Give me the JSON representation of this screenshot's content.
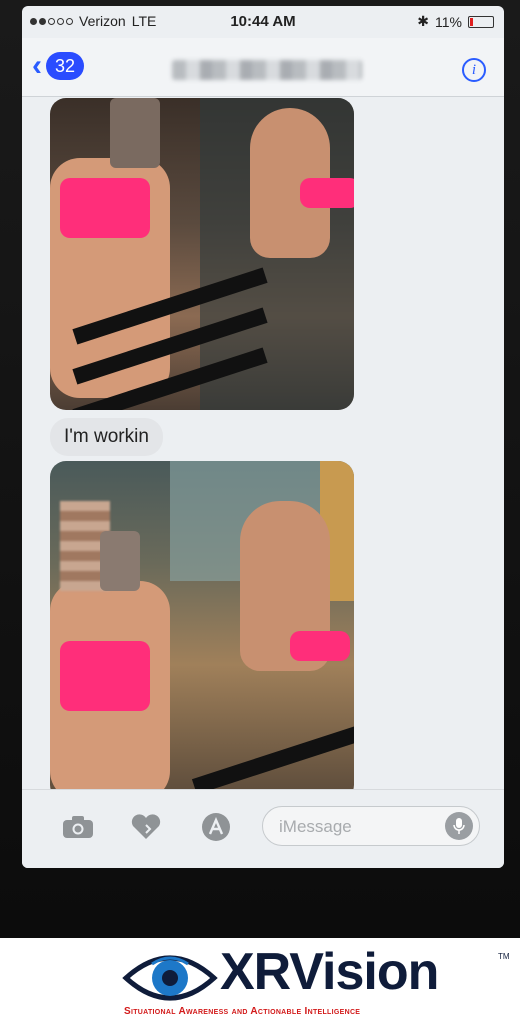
{
  "status_bar": {
    "carrier": "Verizon",
    "network": "LTE",
    "time": "10:44 AM",
    "battery": "11%"
  },
  "nav": {
    "back_count": "32",
    "info_icon": "info-icon"
  },
  "messages": [
    {
      "type": "image",
      "description_icon": "photo"
    },
    {
      "type": "text",
      "text": "I'm workin"
    },
    {
      "type": "image",
      "description_icon": "photo"
    }
  ],
  "input": {
    "placeholder": "iMessage",
    "icons": [
      "camera-icon",
      "digital-touch-heart-icon",
      "app-store-icon",
      "microphone-icon"
    ]
  },
  "footer": {
    "logo": "XRVision",
    "tm": "TM",
    "tagline": "Situational Awareness and Actionable Intelligence"
  },
  "colors": {
    "accent": "#2a5cff",
    "logo_dark": "#0f1c3a",
    "tagline_red": "#d21a1a"
  }
}
